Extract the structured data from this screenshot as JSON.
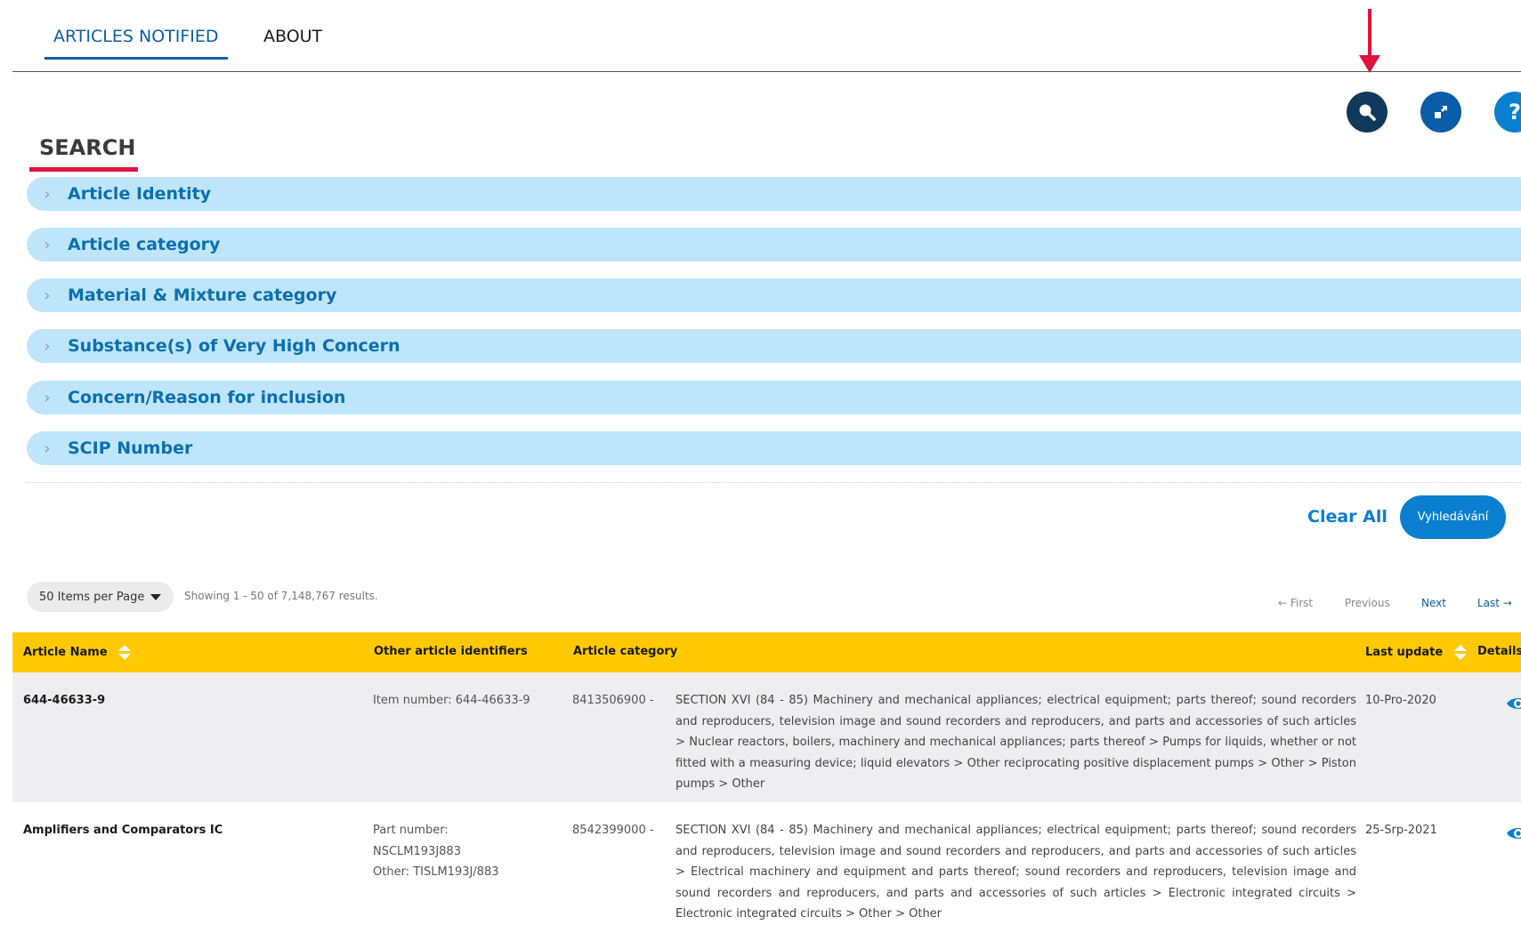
{
  "tabs": {
    "articles_notified": "ARTICLES NOTIFIED",
    "about": "ABOUT"
  },
  "toolbar": {
    "search_icon": "search-icon",
    "expand_icon": "expand-icon",
    "help_glyph": "?"
  },
  "search": {
    "title": "SEARCH",
    "sections": [
      "Article Identity",
      "Article category",
      "Material & Mixture category",
      "Substance(s) of Very High Concern",
      "Concern/Reason for inclusion",
      "SCIP Number"
    ],
    "clear_all": "Clear All",
    "submit": "Vyhledávání"
  },
  "results": {
    "per_page": "50 Items per Page",
    "showing": "Showing 1 - 50 of 7,148,767 results.",
    "pager": {
      "first": "← First",
      "previous": "Previous",
      "next": "Next",
      "last": "Last →"
    },
    "columns": {
      "article_name": "Article Name",
      "other_ids": "Other article identifiers",
      "category": "Article category",
      "last_update": "Last update",
      "details": "Details"
    },
    "rows": [
      {
        "name": "644-46633-9",
        "ids": [
          "Item number: 644-46633-9"
        ],
        "code": "8413506900 -",
        "desc": "SECTION XVI (84 - 85) Machinery and mechanical appliances; electrical equipment; parts thereof; sound recorders and reproducers, television image and sound recorders and reproducers, and parts and accessories of such articles > Nuclear reactors, boilers, machinery and mechanical appliances; parts thereof > Pumps for liquids, whether or not fitted with a measuring device; liquid elevators > Other reciprocating positive displacement pumps > Other > Piston pumps > Other",
        "date": "10-Pro-2020"
      },
      {
        "name": "Amplifiers and Comparators IC",
        "ids": [
          "Part number:",
          "NSCLM193J883",
          "Other: TISLM193J/883"
        ],
        "code": "8542399000 -",
        "desc": "SECTION XVI (84 - 85) Machinery and mechanical appliances; electrical equipment; parts thereof; sound recorders and reproducers, television image and sound recorders and reproducers, and parts and accessories of such articles > Electrical machinery and equipment and parts thereof; sound recorders and reproducers, television image and sound recorders and reproducers, and parts and accessories of such articles > Electronic integrated circuits > Electronic integrated circuits > Other > Other",
        "date": "25-Srp-2021"
      }
    ]
  },
  "colors": {
    "accent": "#0a7fd0",
    "header_bg": "#fec901",
    "accordion_bg": "#bfe5fa",
    "arrow": "#e0143c"
  }
}
